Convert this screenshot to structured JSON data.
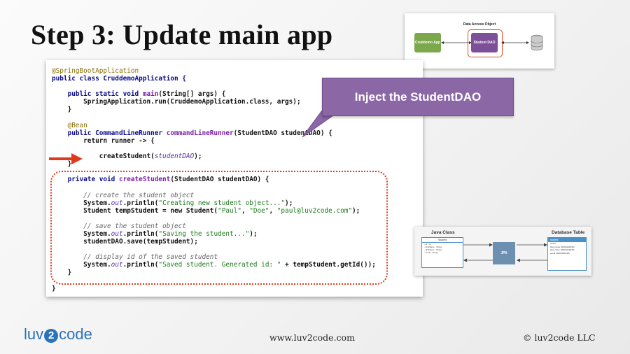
{
  "slide": {
    "title": "Step 3: Update main app",
    "callout_text": "Inject the StudentDAO"
  },
  "code": {
    "annotation_spring": "@SpringBootApplication",
    "class_decl": "public class CruddemoApplication {",
    "main_decl_kw": "public static void ",
    "main_decl_name": "main",
    "main_decl_rest": "(String[] args) {",
    "run_line": "SpringApplication.run(CruddemoApplication.class, args);",
    "close_brace": "}",
    "annotation_bean": "@Bean",
    "runner_kw": "public CommandLineRunner ",
    "runner_name": "commandLineRunner",
    "runner_rest": "(StudentDAO studentDAO) {",
    "return_line": "return runner -> {",
    "create_call_name": "createStudent(",
    "create_call_arg": "studentDAO",
    "create_call_end": ");",
    "private_kw": "private void ",
    "private_name": "createStudent",
    "private_rest": "(StudentDAO studentDAO) {",
    "comment_create": "// create the student object",
    "sysout_prefix": "System.",
    "sysout_out": "out",
    "sysout_println": ".println(",
    "str_creating": "\"Creating new student object...\"",
    "sysout_end": ");",
    "temp_student_a": "Student tempStudent = new Student(",
    "str_paul": "\"Paul\"",
    "str_doe": "\"Doe\"",
    "str_email": "\"paul@luv2code.com\"",
    "comma": ", ",
    "temp_student_end": ");",
    "comment_save": "// save the student object",
    "str_saving": "\"Saving the student...\"",
    "save_line": "studentDAO.save(tempStudent);",
    "comment_display": "// display id of the saved student",
    "str_saved": "\"Saved student. Generated id: \"",
    "saved_rest": " + tempStudent.getId());"
  },
  "dao_diagram": {
    "header": "Data Access Object",
    "app_label": "Cruddemo App",
    "dao_label": "Student DAO",
    "db_icon": "database-icon"
  },
  "jpa_diagram": {
    "java_class_header": "Java Class",
    "db_table_header": "Database Table",
    "class_name": "Student",
    "class_fields": [
      "- id : int",
      "- firstName : String",
      "- lastName : String",
      "- email : String"
    ],
    "jpa_label": "JPA",
    "table_name": "student",
    "table_fields": [
      "id INT",
      "first_name VARCHAR(45)",
      "last_name VARCHAR(45)",
      "email VARCHAR(45)"
    ]
  },
  "footer": {
    "logo_left": "luv",
    "logo_two": "2",
    "logo_right": "code",
    "url": "www.luv2code.com",
    "copyright": "© luv2code LLC"
  },
  "colors": {
    "callout": "#8b67a6",
    "highlight_border": "#e03a1e",
    "logo": "#2a73b8"
  }
}
